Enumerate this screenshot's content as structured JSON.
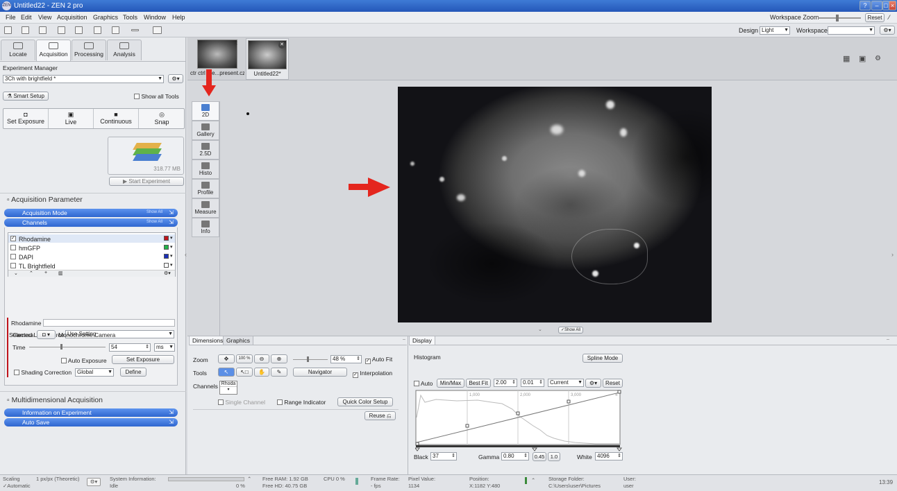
{
  "window": {
    "title": "Untitled22 - ZEN 2 pro",
    "logo": "ZEN"
  },
  "menu": [
    "File",
    "Edit",
    "View",
    "Acquisition",
    "Graphics",
    "Tools",
    "Window",
    "Help"
  ],
  "top_right": {
    "workspace_zoom_label": "Workspace Zoom",
    "reset_label": "Reset",
    "design_label": "Design",
    "design_value": "Light",
    "workspace_label": "Workspace",
    "workspace_value": ""
  },
  "left_tabs": [
    {
      "label": "Locate"
    },
    {
      "label": "Acquisition"
    },
    {
      "label": "Processing"
    },
    {
      "label": "Analysis"
    }
  ],
  "experiment": {
    "manager_label": "Experiment Manager",
    "value": "3Ch with brightfield *",
    "smart_setup": "Smart Setup",
    "show_all_tools": "Show all Tools"
  },
  "acq_buttons": [
    {
      "label": "Set Exposure"
    },
    {
      "label": "Live"
    },
    {
      "label": "Continuous"
    },
    {
      "label": "Snap"
    }
  ],
  "experiment_size": "318.77 MB",
  "start_experiment": "Start Experiment",
  "acquisition_parameter": "Acquisition Parameter",
  "acquisition_mode": "Acquisition Mode",
  "channels_bar": "Channels",
  "show_all": "Show All",
  "channels": [
    {
      "name": "Rhodamine",
      "checked": true,
      "color": "#c0141c"
    },
    {
      "name": "hmGFP",
      "checked": false,
      "color": "#21b34a"
    },
    {
      "name": "DAPI",
      "checked": false,
      "color": "#1a2fb8"
    },
    {
      "name": "TL Brightfield",
      "checked": false,
      "color": "#ffffff"
    }
  ],
  "lightsource": {
    "label": "Selected Lightsource",
    "value": "Use Setting"
  },
  "channel_detail": {
    "name": "Rhodamine",
    "camera_label": "Camera",
    "camera_value": "Monochrome Camera",
    "time_label": "Time",
    "time_value": "54",
    "time_unit": "ms",
    "auto_exposure": "Auto Exposure",
    "set_exposure": "Set Exposure",
    "shading_label": "Shading Correction",
    "shading_value": "Global",
    "define": "Define"
  },
  "multidim": "Multidimensional Acquisition",
  "info_on_experiment": "Information on Experiment",
  "auto_save": "Auto Save",
  "doc_tabs": [
    {
      "label": "ctr ctrl pre...present.czi*"
    },
    {
      "label": "Untitled22*"
    }
  ],
  "view_tabs": [
    {
      "label": "2D"
    },
    {
      "label": "Gallery"
    },
    {
      "label": "2.5D"
    },
    {
      "label": "Histo"
    },
    {
      "label": "Profile"
    },
    {
      "label": "Measure"
    },
    {
      "label": "Info"
    }
  ],
  "show_all_image": "Show All",
  "bottom_tabs_left": [
    "Dimensions",
    "Graphics"
  ],
  "dimensions": {
    "zoom_label": "Zoom",
    "zoom_value": "48 %",
    "zoom_100": "100 %",
    "auto_fit": "Auto Fit",
    "tools_label": "Tools",
    "navigator": "Navigator",
    "interpolation": "Interpolation",
    "channels_label": "Channels",
    "channel_chip": "Rhoda",
    "single_channel": "Single Channel",
    "range_indicator": "Range Indicator",
    "quick_color": "Quick Color Setup",
    "reuse": "Reuse"
  },
  "display": {
    "tab": "Display",
    "histogram_label": "Histogram",
    "spline_mode": "Spline Mode",
    "auto": "Auto",
    "minmax": "Min/Max",
    "best_fit": "Best Fit",
    "v1": "2.00",
    "v2": "0.01",
    "current": "Current",
    "reset": "Reset",
    "ticks": [
      "1,000",
      "2,000",
      "3,000",
      "4"
    ],
    "black_label": "Black",
    "black_value": "37",
    "gamma_label": "Gamma",
    "gamma_value": "0.80",
    "g2": "0.45",
    "g3": "1.0",
    "white_label": "White",
    "white_value": "4096"
  },
  "status": {
    "scaling": "Scaling",
    "scaling_value": "1 px/px (Theoretic)",
    "automatic": "Automatic",
    "sysinfo": "System Information:",
    "idle": "Idle",
    "pct": "0 %",
    "free_ram": "Free RAM: 1.92 GB",
    "free_hd": "Free HD:   40.75 GB",
    "cpu": "CPU 0 %",
    "frame_rate": "Frame Rate:",
    "fps": "- fps",
    "pixel_value": "Pixel Value:",
    "pixel_num": "1134",
    "position": "Position:",
    "position_val": "X:1182  Y:480",
    "storage": "Storage Folder:",
    "storage_path": "C:\\Users\\user\\Pictures",
    "user_label": "User:",
    "user_val": "user",
    "time": "13:39"
  }
}
